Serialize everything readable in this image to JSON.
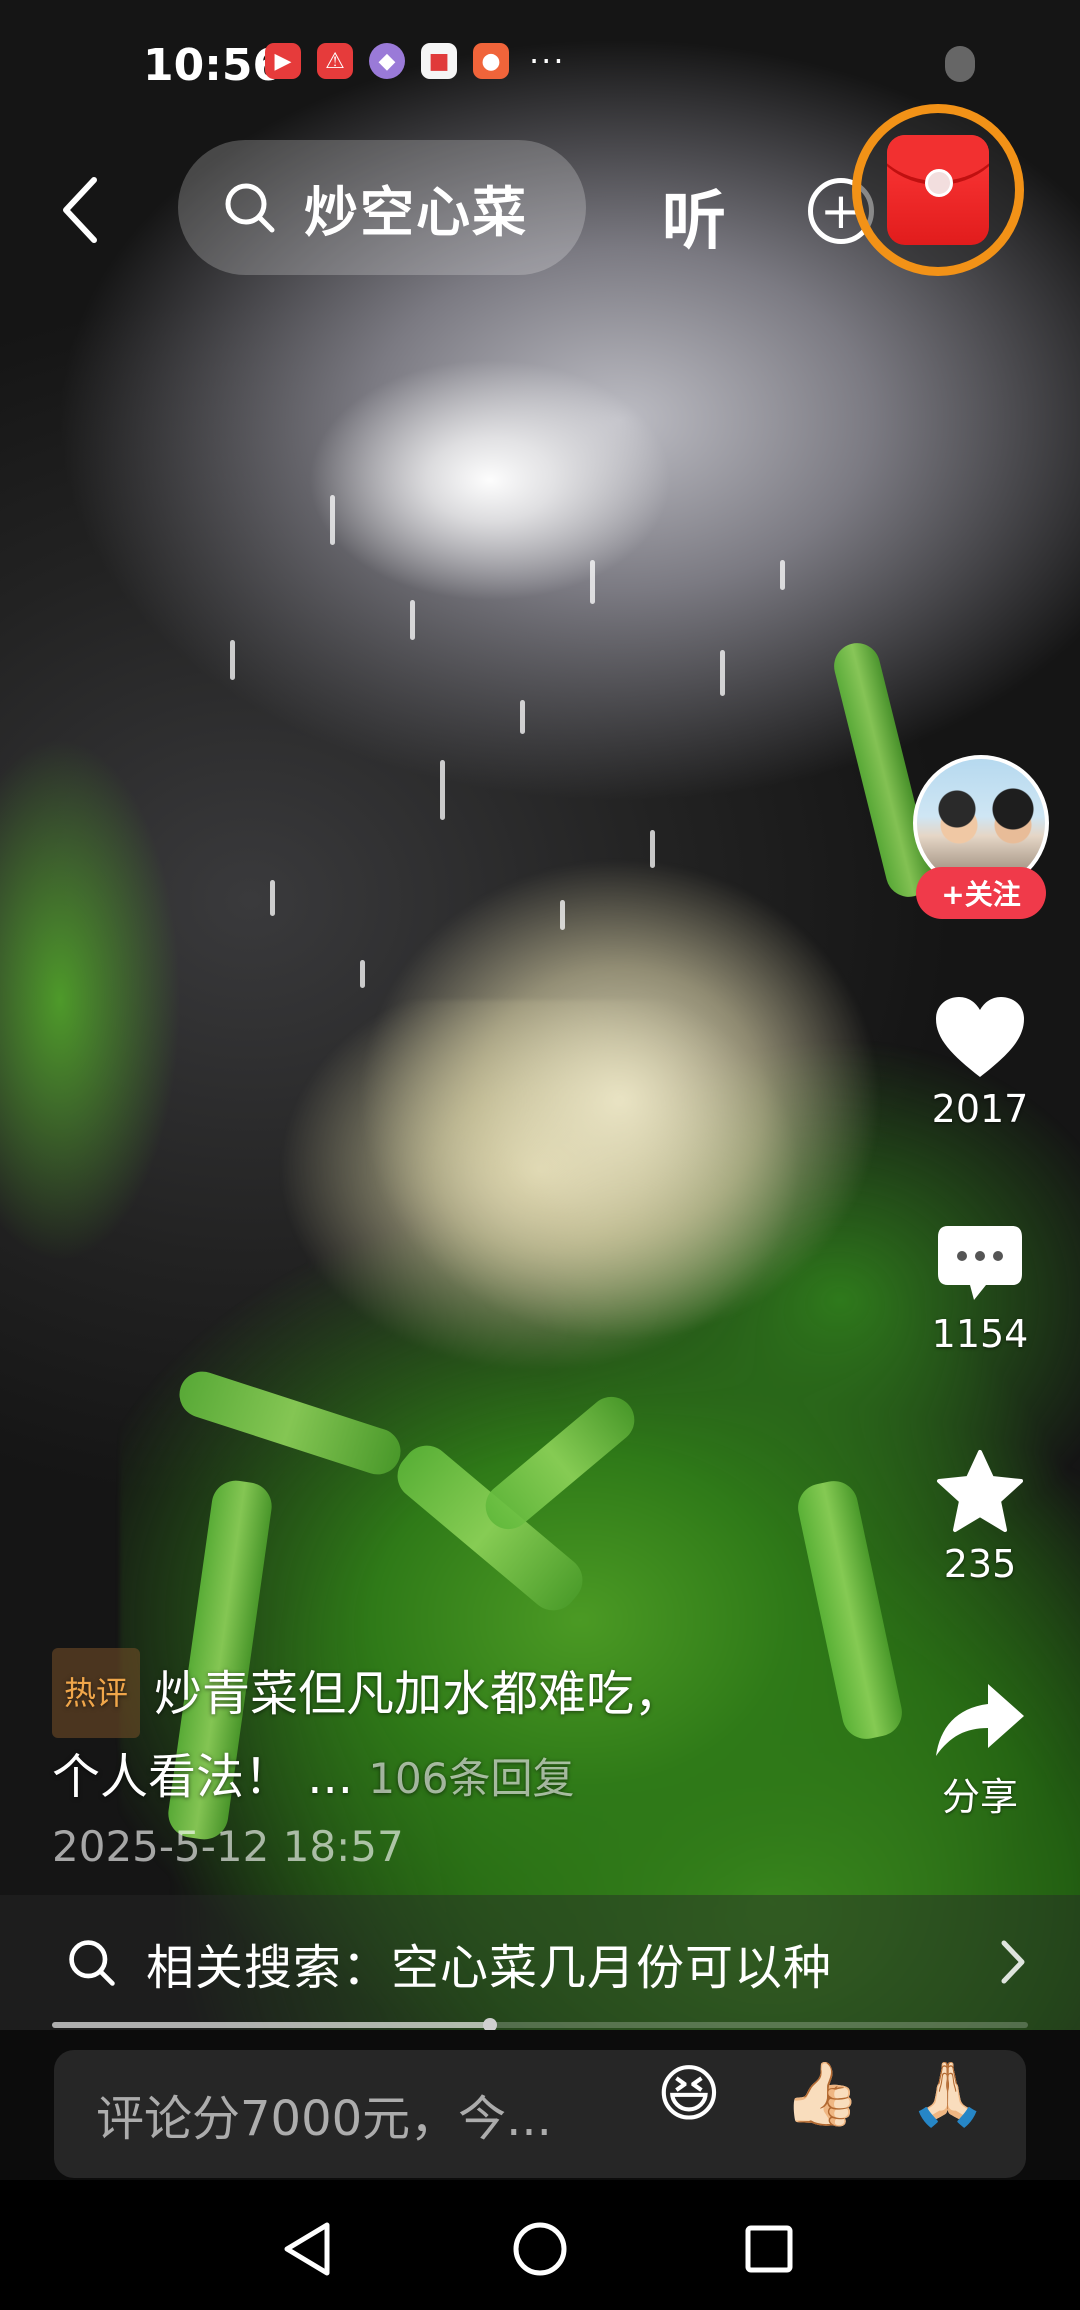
{
  "status_bar": {
    "time": "10:56",
    "notification_icons": [
      "video-app-icon",
      "alert-app-icon",
      "browser-app-icon",
      "reader-app-icon",
      "shop-app-icon"
    ],
    "more": "···"
  },
  "top_bar": {
    "search_query": "炒空心菜",
    "listen_label": "听",
    "plus_label": "+"
  },
  "author": {
    "follow_label": "+关注"
  },
  "actions": {
    "like_count": "2017",
    "comment_count": "1154",
    "favorite_count": "235",
    "share_label": "分享"
  },
  "hot_comment": {
    "tag": "热评",
    "text_line1": "炒青菜但凡加水都难吃，",
    "text_line2": "个人看法！",
    "ellipsis": " ... ",
    "replies": "106条回复",
    "date": "2025-5-12 18:57"
  },
  "related_search": {
    "text": "相关搜索：空心菜几月份可以种"
  },
  "playback": {
    "progress_fraction": 0.45
  },
  "comment_input": {
    "placeholder": "评论分7000元，今...",
    "emojis": [
      "😆",
      "👍🏻",
      "🙏🏻"
    ]
  },
  "colors": {
    "follow_red": "#f03a4a",
    "redpacket_ring": "#f29217",
    "hot_tag": "#f0a64a"
  }
}
